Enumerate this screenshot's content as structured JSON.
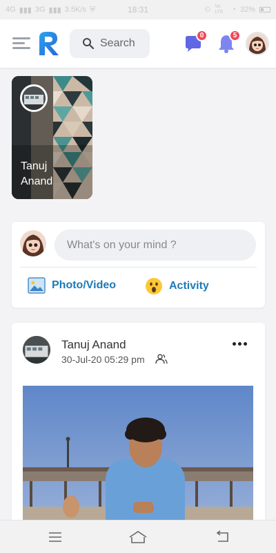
{
  "status_bar": {
    "network1": "4G",
    "network2": "3G",
    "speed": "3.5K/s",
    "time": "18:31",
    "volte": "Vo LTE",
    "battery": "32%"
  },
  "header": {
    "logo_icon": "r-logo-icon",
    "search_placeholder": "Search",
    "messages_badge": "0",
    "notifications_badge": "5"
  },
  "stories": [
    {
      "name": "Tanuj Anand"
    }
  ],
  "composer": {
    "placeholder": "What's on your mind ?",
    "photo_video_label": "Photo/Video",
    "activity_label": "Activity"
  },
  "post": {
    "author": "Tanuj Anand",
    "timestamp": "30-Jul-20 05:29 pm"
  },
  "colors": {
    "accent": "#1b7ab8",
    "messages_icon": "#6066e4",
    "notifications_icon": "#7d86f0",
    "badge": "#ef4b5a"
  }
}
